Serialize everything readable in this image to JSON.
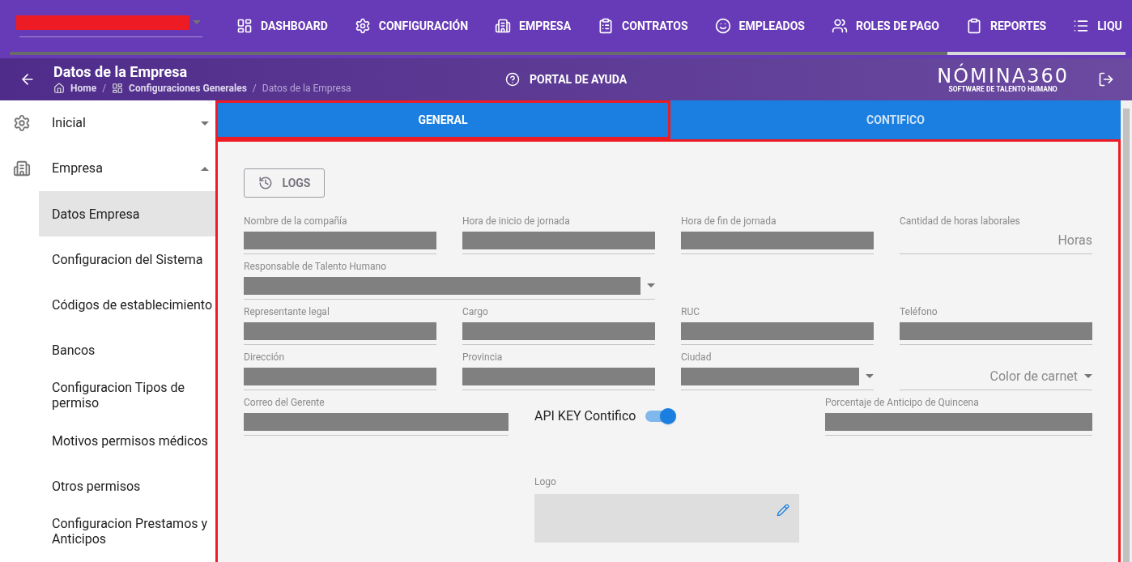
{
  "top_nav": {
    "items": [
      {
        "label": "DASHBOARD"
      },
      {
        "label": "CONFIGURACIÓN"
      },
      {
        "label": "EMPRESA"
      },
      {
        "label": "CONTRATOS"
      },
      {
        "label": "EMPLEADOS"
      },
      {
        "label": "ROLES DE PAGO"
      },
      {
        "label": "REPORTES"
      },
      {
        "label": "LIQU"
      }
    ]
  },
  "header": {
    "title": "Datos de la Empresa",
    "breadcrumbs": [
      {
        "label": "Home",
        "current": false
      },
      {
        "label": "Configuraciones Generales",
        "current": false
      },
      {
        "label": "Datos de la Empresa",
        "current": true
      }
    ],
    "breadcrumb_separator": "/",
    "help": "PORTAL DE AYUDA",
    "logo": {
      "name": "NÓMINA360",
      "tagline": "SOFTWARE DE TALENTO HUMANO"
    }
  },
  "sidebar": {
    "items": [
      {
        "label": "Inicial",
        "expanded": false
      },
      {
        "label": "Empresa",
        "expanded": true,
        "children": [
          {
            "label": "Datos Empresa",
            "selected": true
          },
          {
            "label": "Configuracion del Sistema",
            "selected": false
          },
          {
            "label": "Códigos de establecimiento",
            "selected": false
          },
          {
            "label": "Bancos",
            "selected": false
          },
          {
            "label": "Configuracion Tipos de permiso",
            "selected": false
          },
          {
            "label": "Motivos permisos médicos",
            "selected": false
          },
          {
            "label": "Otros permisos",
            "selected": false
          },
          {
            "label": "Configuracion Prestamos y Anticipos",
            "selected": false
          }
        ]
      }
    ]
  },
  "tabs": [
    {
      "label": "GENERAL",
      "selected": true
    },
    {
      "label": "CONTIFICO",
      "selected": false
    }
  ],
  "form": {
    "logs_button": "LOGS",
    "rows": [
      [
        {
          "label": "Nombre de la compañía",
          "kind": "text",
          "redacted": true
        },
        {
          "label": "Hora de inicio de jornada",
          "kind": "text",
          "redacted": true
        },
        {
          "label": "Hora de fin de jornada",
          "kind": "text",
          "redacted": true
        },
        {
          "label": "Cantidad de horas laborales",
          "kind": "text",
          "redacted": false,
          "suffix": "Horas"
        }
      ],
      [
        {
          "label": "Responsable de Talento Humano",
          "kind": "select",
          "redacted": true
        }
      ],
      [
        {
          "label": "Representante legal",
          "kind": "text",
          "redacted": true
        },
        {
          "label": "Cargo",
          "kind": "text",
          "redacted": true
        },
        {
          "label": "RUC",
          "kind": "text",
          "redacted": true
        },
        {
          "label": "Teléfono",
          "kind": "text",
          "redacted": true
        }
      ],
      [
        {
          "label": "Dirección",
          "kind": "text",
          "redacted": true
        },
        {
          "label": "Provincia",
          "kind": "text",
          "redacted": true
        },
        {
          "label": "Ciudad",
          "kind": "select",
          "redacted": true
        },
        {
          "placeholder": "Color de carnet",
          "kind": "select",
          "redacted": false
        }
      ]
    ],
    "manager_email": {
      "label": "Correo del Gerente",
      "redacted": true
    },
    "api_toggle": {
      "label": "API KEY Contifico",
      "on": true
    },
    "advance_percent": {
      "label": "Porcentaje de Anticipo de Quincena",
      "redacted": true
    },
    "logo_label": "Logo"
  }
}
